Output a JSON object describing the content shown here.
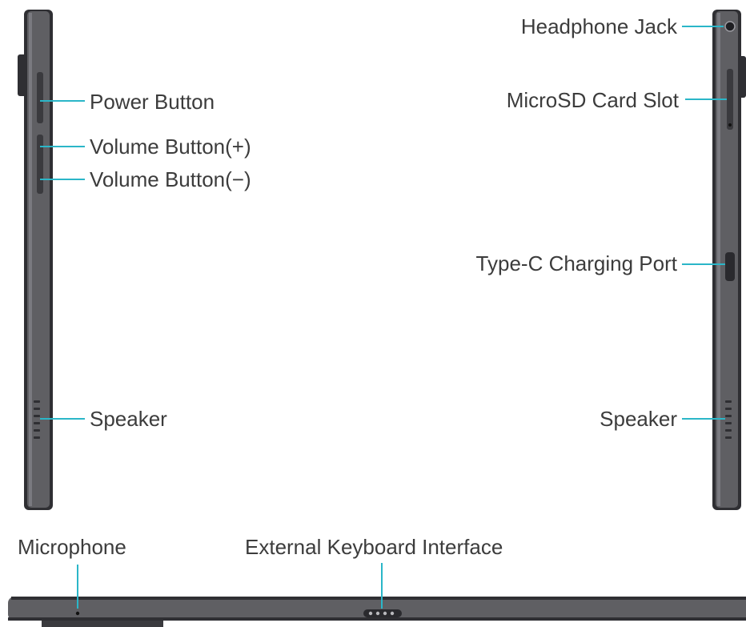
{
  "colors": {
    "device_body": "#5f5f63",
    "device_edge": "#2f2f33",
    "leader_line": "#2bb6c8",
    "label_text": "#3c3c3c"
  },
  "left_side": {
    "labels": {
      "power": "Power Button",
      "vol_up": "Volume Button(+)",
      "vol_down": "Volume Button(−)",
      "speaker": "Speaker"
    }
  },
  "right_side": {
    "labels": {
      "headphone": "Headphone Jack",
      "microsd": "MicroSD Card Slot",
      "typec": "Type-C Charging Port",
      "speaker": "Speaker"
    }
  },
  "bottom_side": {
    "labels": {
      "microphone": "Microphone",
      "keyboard": "External Keyboard Interface"
    }
  }
}
